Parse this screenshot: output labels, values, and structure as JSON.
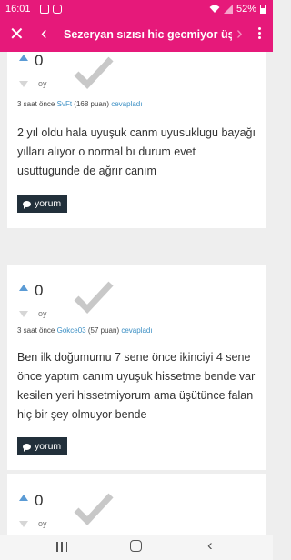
{
  "status_bar": {
    "time": "16:01",
    "battery": "52%",
    "battery_level": 0.52
  },
  "app_bar": {
    "close_icon": "close-icon",
    "back_icon": "chevron-left-icon",
    "title": "Sezeryan sızısı hic gecmiyor üşüt...",
    "forward_icon": "chevron-right-icon",
    "more_icon": "more-vert-icon"
  },
  "answers": [
    {
      "votes": "0",
      "vote_label": "oy",
      "time": "3 saat önce",
      "user": "SvFt",
      "points": "(168 puan)",
      "action": "cevapladı",
      "body": "2 yıl oldu hala uyuşuk canm uyusuklugu bayağı yılları alıyor o normal bı durum evet usuttugunde de ağrır canım",
      "comment_label": "yorum"
    },
    {
      "votes": "0",
      "vote_label": "oy",
      "time": "3 saat önce",
      "user": "Gokce03",
      "points": "(57 puan)",
      "action": "cevapladı",
      "body": "Ben ilk doğumumu 7 sene önce ikinciyi 4 sene önce yaptım canım uyuşuk hissetme bende var kesilen yeri hissetmiyorum ama üşütünce falan hiç bir şey olmuyor bende",
      "comment_label": "yorum"
    },
    {
      "votes": "0",
      "vote_label": "oy"
    }
  ],
  "colors": {
    "brand": "#e6197a",
    "button_dark": "#22303b",
    "link": "#3b8fc4",
    "upvote": "#5b9bd5"
  }
}
